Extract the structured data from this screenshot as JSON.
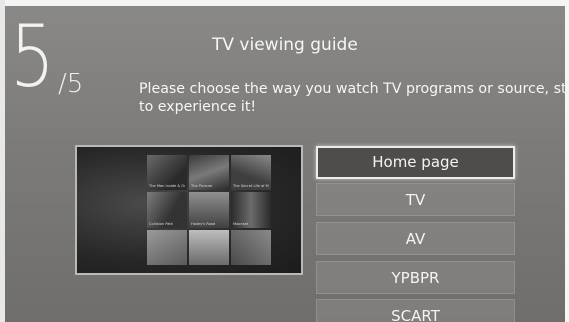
{
  "step": {
    "current": "5",
    "total": "/5"
  },
  "title": "TV viewing guide",
  "subtitle_line1": "Please choose the way you watch TV programs or source, start",
  "subtitle_line2": "to experience it!",
  "preview": {
    "tiles": [
      "The Man Inside & Out",
      "The Pursuer",
      "The Secret Life of Mid",
      "Collision Path",
      "Hailey's Road",
      "Moonset",
      "",
      "",
      ""
    ]
  },
  "menu": {
    "selected_index": 0,
    "items": [
      "Home page",
      "TV",
      "AV",
      "YPBPR",
      "SCART"
    ]
  }
}
